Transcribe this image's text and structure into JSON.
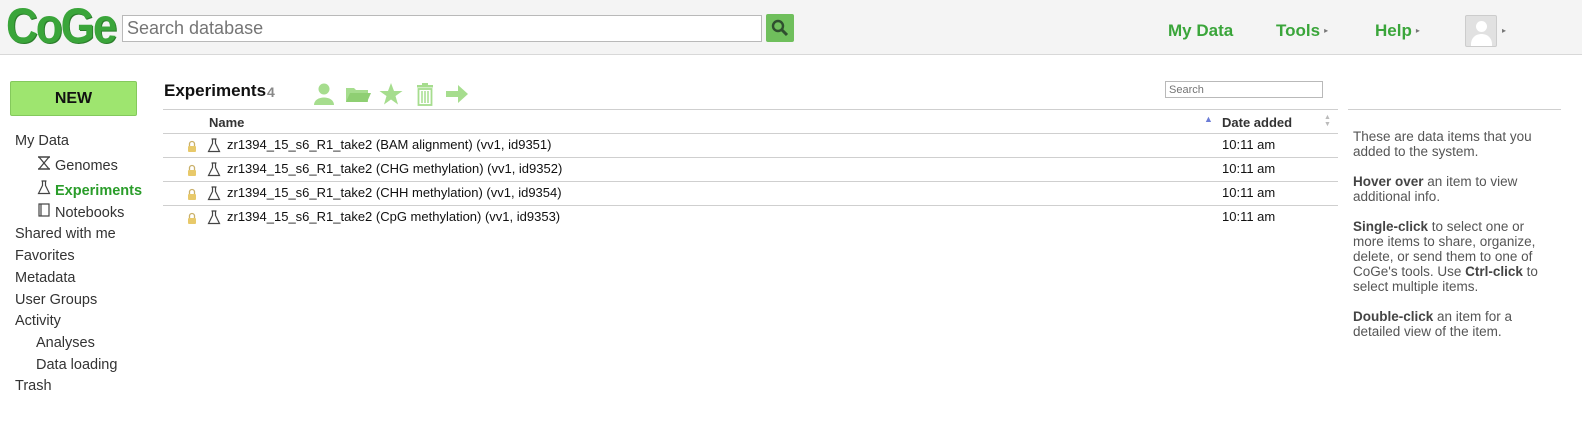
{
  "header": {
    "logo": "CoGe",
    "search_placeholder": "Search database",
    "nav": [
      {
        "label": "My Data"
      },
      {
        "label": "Tools",
        "caret": "▸"
      },
      {
        "label": "Help",
        "caret": "▸"
      }
    ],
    "avatar_caret": "▸"
  },
  "sidebar": {
    "new_label": "NEW",
    "items": [
      {
        "label": "My Data"
      },
      {
        "label": "Genomes",
        "icon": "genome-icon"
      },
      {
        "label": "Experiments",
        "icon": "flask-icon",
        "active": true
      },
      {
        "label": "Notebooks",
        "icon": "notebook-icon"
      },
      {
        "label": "Shared with me"
      },
      {
        "label": "Favorites"
      },
      {
        "label": "Metadata"
      },
      {
        "label": "User Groups"
      },
      {
        "label": "Activity"
      },
      {
        "label": "Analyses"
      },
      {
        "label": "Data loading"
      },
      {
        "label": "Trash"
      }
    ]
  },
  "main": {
    "title": "Experiments",
    "count": "4",
    "toolbar_icons": [
      "share-user-icon",
      "folder-icon",
      "star-icon",
      "trash-icon",
      "send-arrow-icon"
    ],
    "search_placeholder": "Search",
    "columns": {
      "name": "Name",
      "date": "Date added"
    },
    "rows": [
      {
        "name": "zr1394_15_s6_R1_take2 (BAM alignment) (vv1, id9351)",
        "date": "10:11 am"
      },
      {
        "name": "zr1394_15_s6_R1_take2 (CHG methylation) (vv1, id9352)",
        "date": "10:11 am"
      },
      {
        "name": "zr1394_15_s6_R1_take2 (CHH methylation) (vv1, id9354)",
        "date": "10:11 am"
      },
      {
        "name": "zr1394_15_s6_R1_take2 (CpG methylation) (vv1, id9353)",
        "date": "10:11 am"
      }
    ]
  },
  "info_panel": {
    "p1": "These are data items that you added to the system.",
    "p2_bold": "Hover over",
    "p2_rest": " an item to view additional info.",
    "p3_bold": "Single-click",
    "p3_mid": " to select one or more items to share, organize, delete, or send them to one of CoGe's tools. Use ",
    "p3_bold2": "Ctrl-click",
    "p3_rest": " to select multiple items.",
    "p4_bold": "Double-click",
    "p4_rest": " an item for a detailed view of the item."
  },
  "colors": {
    "brand_green": "#3aa53a",
    "new_button": "#9ee56f",
    "toolbar_icon": "#a6dd8e"
  }
}
